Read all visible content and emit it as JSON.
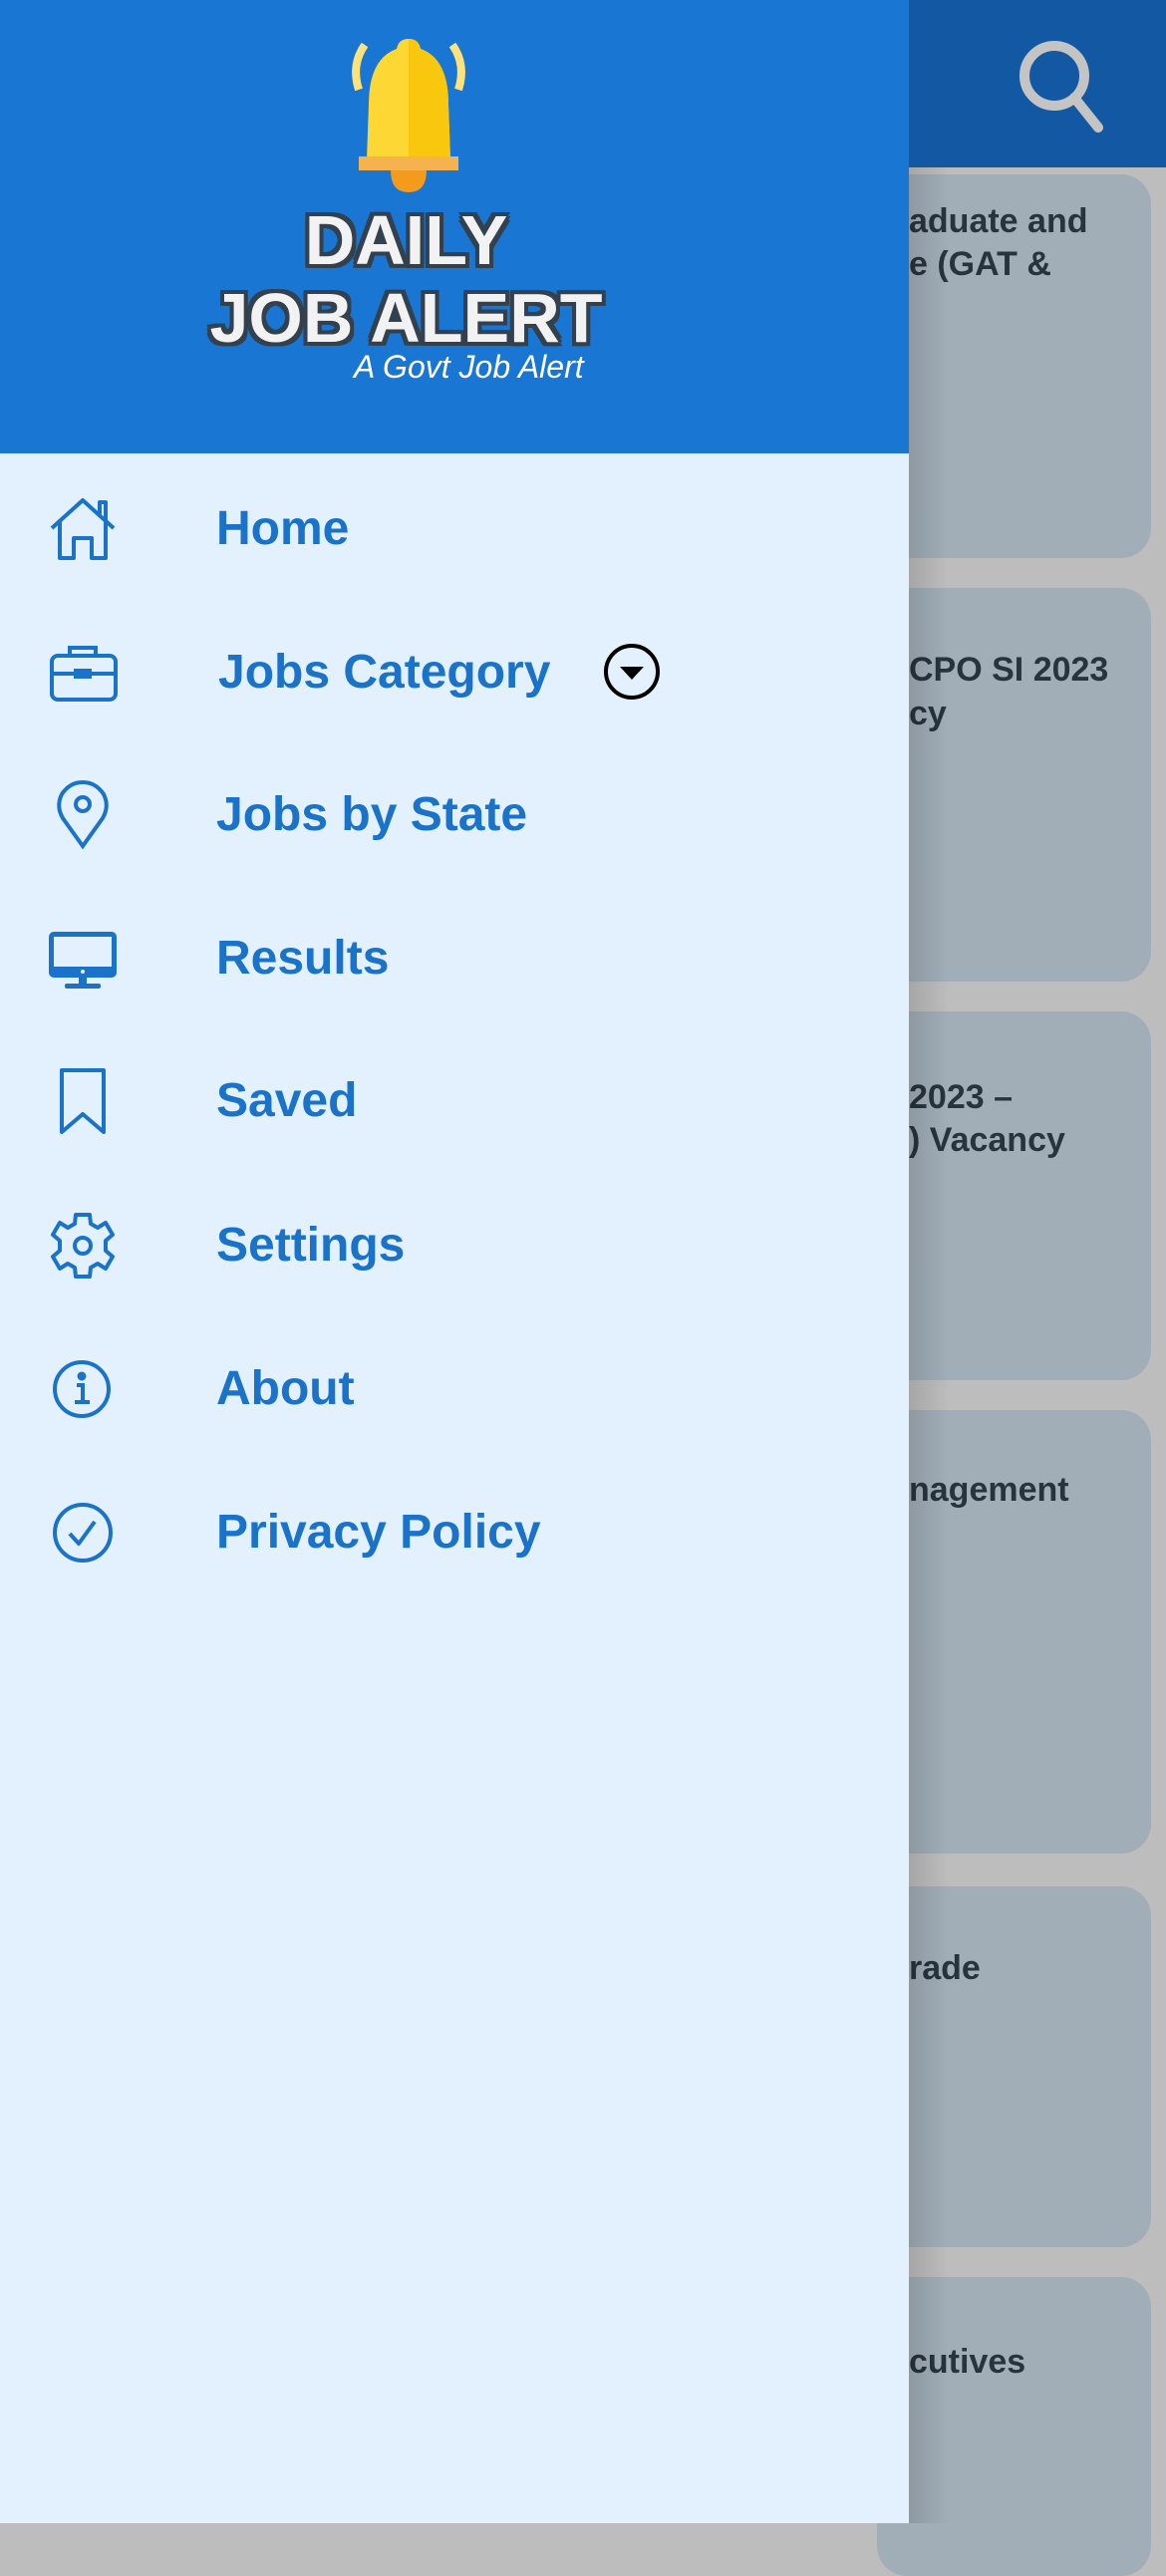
{
  "background": {
    "search_icon": "search-icon",
    "cards": [
      {
        "lines": [
          "aduate and",
          "e (GAT &"
        ]
      },
      {
        "lines": [
          "CPO SI 2023",
          "cy"
        ]
      },
      {
        "lines": [
          "2023 –",
          ") Vacancy"
        ]
      },
      {
        "lines": [
          "nagement"
        ]
      },
      {
        "lines": [
          "rade"
        ]
      },
      {
        "lines": [
          "cutives"
        ]
      }
    ]
  },
  "drawer": {
    "logo": {
      "line1": "DAILY",
      "line2": "JOB ALERT",
      "tagline": "A Govt Job Alert"
    },
    "items": [
      {
        "label": "Home",
        "icon": "home-icon"
      },
      {
        "label": "Jobs Category",
        "icon": "briefcase-icon",
        "expand_icon": "dropdown-circle-icon"
      },
      {
        "label": "Jobs by State",
        "icon": "location-pin-icon"
      },
      {
        "label": "Results",
        "icon": "monitor-icon"
      },
      {
        "label": "Saved",
        "icon": "bookmark-icon"
      },
      {
        "label": "Settings",
        "icon": "gear-icon"
      },
      {
        "label": "About",
        "icon": "info-icon"
      },
      {
        "label": "Privacy Policy",
        "icon": "check-circle-icon"
      }
    ]
  },
  "colors": {
    "accent": "#1976d2",
    "text": "#1a73c9",
    "drawer_bg": "#e3f1ff"
  }
}
